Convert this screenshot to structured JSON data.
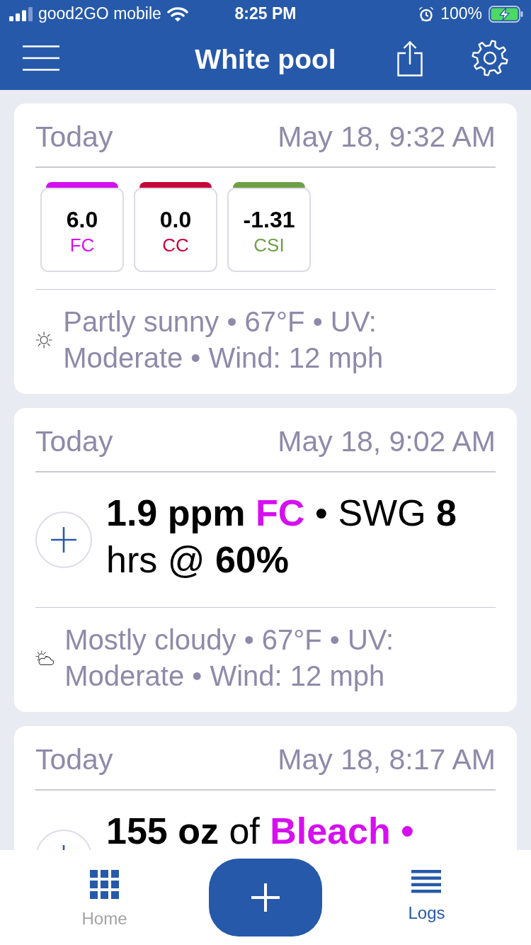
{
  "status_bar": {
    "carrier": "good2GO mobile",
    "time": "8:25 PM",
    "battery": "100%"
  },
  "header": {
    "title": "White pool"
  },
  "log_entries": [
    {
      "kind": "readings",
      "day": "Today",
      "timestamp": "May 18, 9:32 AM",
      "cut_off": false,
      "readings": [
        {
          "value": "6.0",
          "label": "FC",
          "color": "#d40ff0"
        },
        {
          "value": "0.0",
          "label": "CC",
          "color": "#c6053a"
        },
        {
          "value": "-1.31",
          "label": "CSI",
          "color": "#6e9f45"
        }
      ],
      "weather": {
        "kind": "sunny",
        "text": "Partly sunny • 67°F • UV: Moderate • Wind: 12 mph"
      }
    },
    {
      "kind": "treatment",
      "day": "Today",
      "timestamp": "May 18, 9:02 AM",
      "cut_off": false,
      "segments": [
        {
          "text": "1.9 ppm",
          "kind": "bold"
        },
        {
          "text": "FC",
          "kind": "accent"
        },
        {
          "text": "• SWG",
          "kind": "plain"
        },
        {
          "text": "8",
          "kind": "bold"
        },
        {
          "text": "hrs @",
          "kind": "plain"
        },
        {
          "text": "60%",
          "kind": "bold"
        }
      ],
      "weather": {
        "kind": "cloudy",
        "text": "Mostly cloudy • 67°F • UV: Moderate • Wind: 12 mph"
      }
    },
    {
      "kind": "treatment",
      "day": "Today",
      "timestamp": "May 18, 8:17 AM",
      "cut_off": true,
      "segments": [
        {
          "text": "155 oz",
          "kind": "bold"
        },
        {
          "text": "of",
          "kind": "plain"
        },
        {
          "text": "Bleach •",
          "kind": "accent"
        }
      ]
    }
  ],
  "bottom_nav": {
    "tabs": [
      {
        "label": "Home",
        "kind": "home",
        "selected": false
      },
      {
        "label": "Logs",
        "kind": "logs",
        "selected": true
      }
    ]
  }
}
